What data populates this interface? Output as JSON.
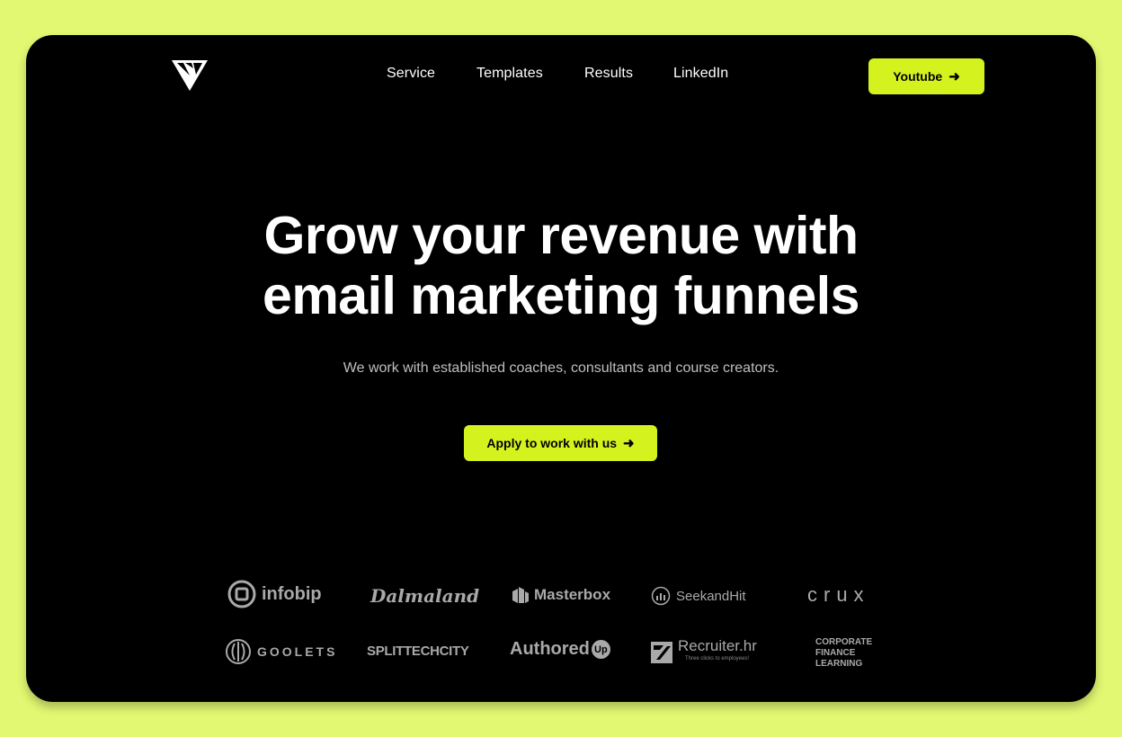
{
  "nav": {
    "items": [
      "Service",
      "Templates",
      "Results",
      "LinkedIn"
    ],
    "cta_label": "Youtube"
  },
  "hero": {
    "headline_line1": "Grow your revenue with",
    "headline_line2": "email marketing funnels",
    "subtitle": "We work with established coaches, consultants and course creators.",
    "cta_label": "Apply to work with us"
  },
  "clients": {
    "row1": [
      "infobip",
      "Dalmaland",
      "Masterbox",
      "SeekandHit",
      "crux"
    ],
    "row2": [
      "GOOLETS",
      "SPLITTECHCITY",
      "Authored",
      "Recruiter.hr",
      "CORPORATE FINANCE LEARNING"
    ],
    "authored_suffix": "Up",
    "recruiter_tagline": "Three clicks to employees!",
    "cfl_lines": [
      "CORPORATE",
      "FINANCE",
      "LEARNING"
    ]
  },
  "icons": {
    "logo": "triangle-logo-icon",
    "arrow": "arrow-right-icon"
  },
  "colors": {
    "background": "#e2f872",
    "accent": "#d4f21e",
    "frame": "#000000",
    "logo_gray": "#a9a9a9"
  }
}
